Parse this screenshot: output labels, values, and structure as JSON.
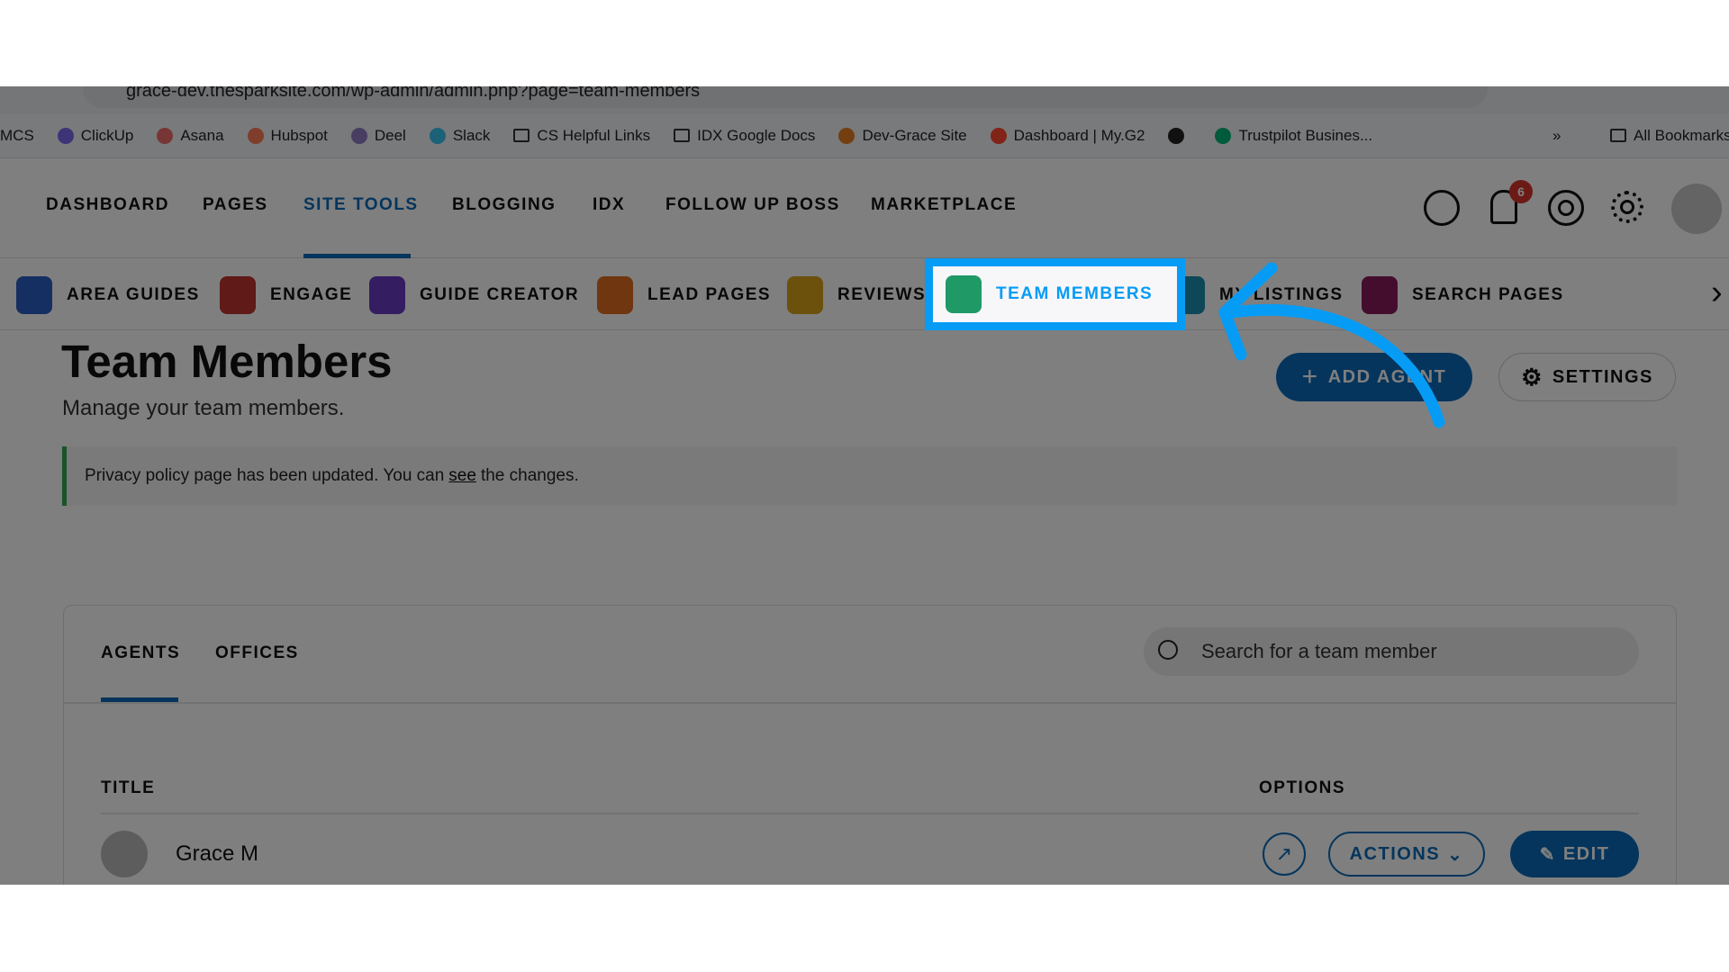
{
  "browser": {
    "url": "grace-dev.thesparksite.com/wp-admin/admin.php?page=team-members",
    "bookmarks": [
      {
        "label": "MCS",
        "color": ""
      },
      {
        "label": "ClickUp",
        "color": "#7b68ee"
      },
      {
        "label": "Asana",
        "color": "#f06a6a"
      },
      {
        "label": "Hubspot",
        "color": "#ff7a59"
      },
      {
        "label": "Deel",
        "color": "#8e7cc3"
      },
      {
        "label": "Slack",
        "color": "#36c5f0"
      },
      {
        "label": "CS Helpful Links",
        "color": "folder"
      },
      {
        "label": "IDX Google Docs",
        "color": "folder"
      },
      {
        "label": "Dev-Grace Site",
        "color": "#e67e22"
      },
      {
        "label": "Dashboard | My.G2",
        "color": "#ff492c"
      },
      {
        "label": "",
        "color": "#222"
      },
      {
        "label": "Trustpilot Busines...",
        "color": "#00b67a"
      }
    ],
    "more": "»",
    "all_bookmarks": "All Bookmarks"
  },
  "nav": {
    "items": [
      "DASHBOARD",
      "PAGES",
      "SITE TOOLS",
      "BLOGGING",
      "IDX",
      "FOLLOW UP BOSS",
      "MARKETPLACE"
    ],
    "active": "SITE TOOLS",
    "notification_count": "6"
  },
  "subnav": {
    "items": [
      {
        "label": "AREA GUIDES",
        "color": "#2d5fc4"
      },
      {
        "label": "ENGAGE",
        "color": "#c0342f"
      },
      {
        "label": "GUIDE CREATOR",
        "color": "#6a3bc4"
      },
      {
        "label": "LEAD PAGES",
        "color": "#e06d1f"
      },
      {
        "label": "REVIEWS",
        "color": "#d9a21b"
      },
      {
        "label": "TEAM MEMBERS",
        "color": "#1f9a66"
      },
      {
        "label": "MY LISTINGS",
        "color": "#1a8fb0"
      },
      {
        "label": "SEARCH PAGES",
        "color": "#8a1b5a"
      }
    ]
  },
  "page": {
    "title": "Team Members",
    "subtitle": "Manage your team members.",
    "add_agent": "ADD AGENT",
    "settings": "SETTINGS"
  },
  "notice": {
    "before": "Privacy policy page has been updated. You can",
    "link": "see",
    "after": "the changes.",
    "accent": "#3aa655"
  },
  "card": {
    "tabs": [
      "AGENTS",
      "OFFICES"
    ],
    "active_tab": "AGENTS",
    "search_placeholder": "Search for a team member",
    "columns": [
      "TITLE",
      "OPTIONS"
    ],
    "rows": [
      {
        "name": "Grace M",
        "actions": "ACTIONS",
        "edit": "EDIT"
      }
    ]
  },
  "annotation": {
    "highlight_color": "#069cf5",
    "highlight_target": "TEAM MEMBERS"
  }
}
